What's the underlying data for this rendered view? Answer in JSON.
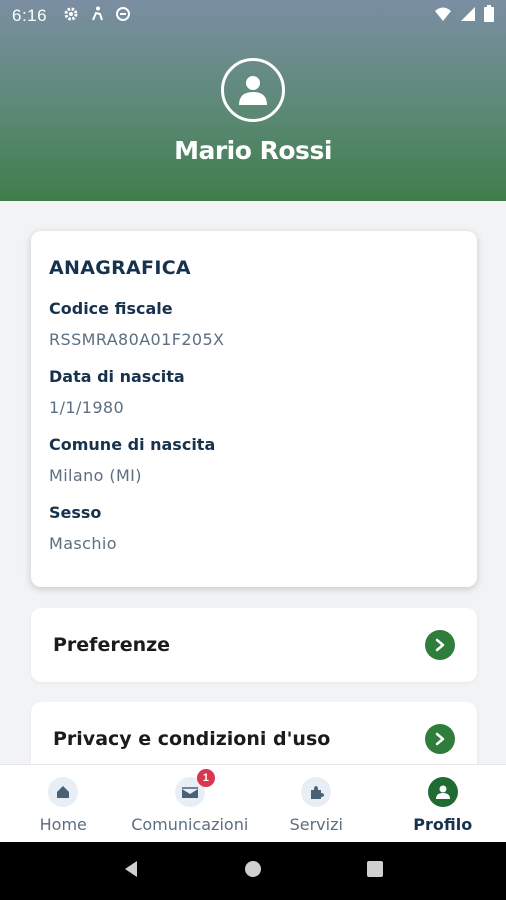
{
  "status_bar": {
    "time": "6:16",
    "left_icons": [
      "gear-icon",
      "accessibility-icon",
      "sync-icon"
    ],
    "right_icons": [
      "wifi-icon",
      "signal-icon",
      "battery-icon"
    ]
  },
  "header": {
    "user_name": "Mario Rossi"
  },
  "anagrafica": {
    "title": "ANAGRAFICA",
    "fields": [
      {
        "label": "Codice fiscale",
        "value": "RSSMRA80A01F205X"
      },
      {
        "label": "Data di nascita",
        "value": "1/1/1980"
      },
      {
        "label": "Comune di nascita",
        "value": "Milano (MI)"
      },
      {
        "label": "Sesso",
        "value": "Maschio"
      }
    ]
  },
  "menu": [
    {
      "label": "Preferenze"
    },
    {
      "label": "Privacy e condizioni d'uso"
    }
  ],
  "bottom_nav": {
    "items": [
      {
        "label": "Home",
        "icon": "home-icon"
      },
      {
        "label": "Comunicazioni",
        "icon": "mail-icon",
        "badge": "1"
      },
      {
        "label": "Servizi",
        "icon": "puzzle-icon"
      },
      {
        "label": "Profilo",
        "icon": "user-icon",
        "active": true
      }
    ]
  },
  "colors": {
    "accent_green": "#2e7d3a",
    "text_dark": "#17324d",
    "badge_red": "#d9364f"
  }
}
